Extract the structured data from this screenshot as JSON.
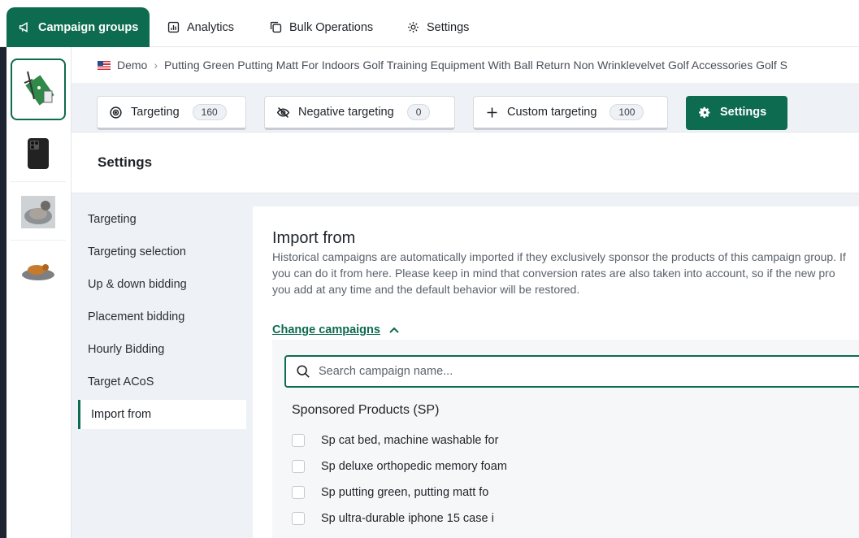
{
  "nav": {
    "tabs": [
      {
        "label": "Campaign groups",
        "icon": "megaphone-icon"
      },
      {
        "label": "Analytics",
        "icon": "chart-icon"
      },
      {
        "label": "Bulk Operations",
        "icon": "copy-icon"
      },
      {
        "label": "Settings",
        "icon": "gear-icon"
      }
    ]
  },
  "breadcrumb": {
    "account": "Demo",
    "product": "Putting Green Putting Matt For Indoors Golf Training Equipment With Ball Return Non Wrinklevelvet Golf Accessories Golf S"
  },
  "tabs": {
    "targeting": {
      "label": "Targeting",
      "count": "160"
    },
    "negative": {
      "label": "Negative targeting",
      "count": "0"
    },
    "custom": {
      "label": "Custom targeting",
      "count": "100"
    },
    "settings": {
      "label": "Settings"
    }
  },
  "page": {
    "heading": "Settings"
  },
  "side_menu": [
    "Targeting",
    "Targeting selection",
    "Up & down bidding",
    "Placement bidding",
    "Hourly Bidding",
    "Target ACoS",
    "Import from"
  ],
  "import": {
    "title": "Import from",
    "desc_lines": [
      "Historical campaigns are automatically imported if they exclusively sponsor the products of this campaign group. If",
      "you can do it from here. Please keep in mind that conversion rates are also taken into account, so if the new pro",
      "you add at any time and the default behavior will be restored."
    ],
    "change_link": "Change campaigns",
    "search_placeholder": "Search campaign name...",
    "group_title": "Sponsored Products (SP)",
    "campaigns": [
      "Sp cat bed, machine washable for",
      "Sp deluxe orthopedic memory foam",
      "Sp putting green, putting matt fo",
      "Sp ultra-durable iphone 15 case i"
    ]
  },
  "colors": {
    "accent": "#0d6b4f",
    "background": "#eef1f5"
  }
}
